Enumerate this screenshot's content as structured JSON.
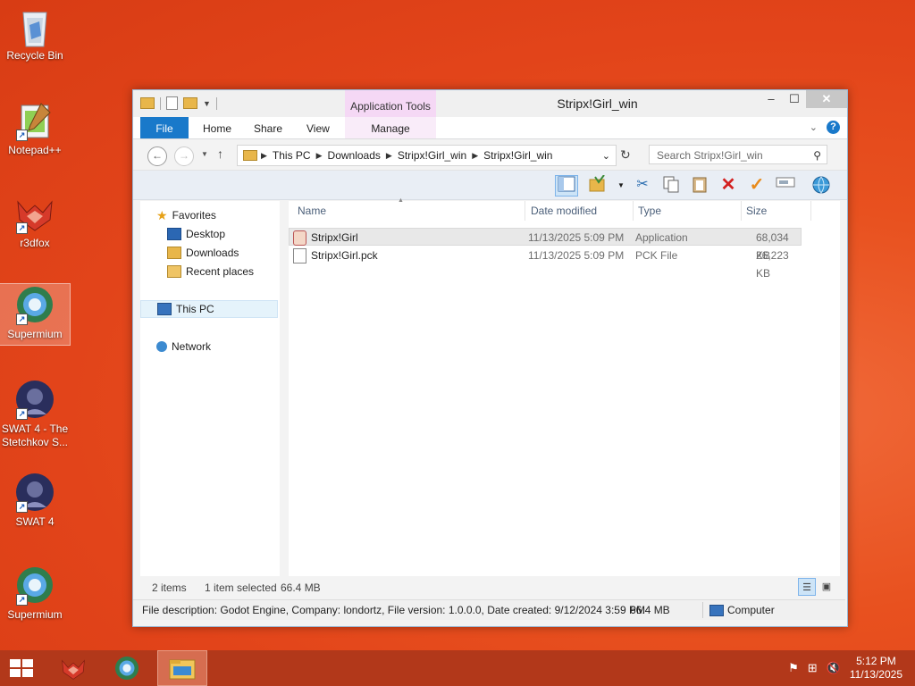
{
  "desktop": {
    "icons": [
      {
        "label": "Recycle Bin"
      },
      {
        "label": "Notepad++"
      },
      {
        "label": "r3dfox"
      },
      {
        "label": "Supermium"
      },
      {
        "label": "SWAT 4 - The Stetchkov S..."
      },
      {
        "label": "SWAT 4"
      },
      {
        "label": "Supermium"
      }
    ]
  },
  "window": {
    "title": "Stripx!Girl_win",
    "app_tools": "Application Tools",
    "tabs": [
      "File",
      "Home",
      "Share",
      "View",
      "Manage"
    ],
    "address": [
      "This PC",
      "Downloads",
      "Stripx!Girl_win",
      "Stripx!Girl_win"
    ],
    "search_placeholder": "Search Stripx!Girl_win",
    "nav": {
      "favorites": "Favorites",
      "desktop": "Desktop",
      "downloads": "Downloads",
      "recent": "Recent places",
      "thispc": "This PC",
      "network": "Network"
    },
    "columns": {
      "name": "Name",
      "date": "Date modified",
      "type": "Type",
      "size": "Size"
    },
    "files": [
      {
        "name": "Stripx!Girl",
        "date": "11/13/2025 5:09 PM",
        "type": "Application",
        "size": "68,034 KB"
      },
      {
        "name": "Stripx!Girl.pck",
        "date": "11/13/2025 5:09 PM",
        "type": "PCK File",
        "size": "26,223 KB"
      }
    ],
    "status": {
      "items": "2 items",
      "selected": "1 item selected",
      "size": "66.4 MB"
    },
    "details": {
      "description": "File description: Godot Engine, Company: londortz, File version: 1.0.0.0, Date created: 9/12/2024 3:59 PM",
      "size": "66.4 MB",
      "computer": "Computer"
    }
  },
  "taskbar": {
    "time": "5:12 PM",
    "date": "11/13/2025"
  },
  "colors": {
    "accent": "#1979ca",
    "desktop": "#e2441a",
    "taskbar": "#b2381a"
  }
}
